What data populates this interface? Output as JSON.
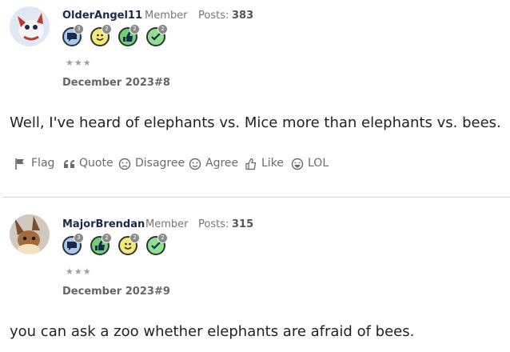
{
  "posts": [
    {
      "username": "OlderAngel11",
      "role": "Member",
      "posts_label": "Posts:",
      "posts_count": "383",
      "badges": [
        {
          "icon": "speech-bubble-icon",
          "count": "3",
          "color": "#a9c9f0"
        },
        {
          "icon": "smiley-face-icon",
          "count": "2",
          "color": "#f6e97a"
        },
        {
          "icon": "thumbs-up-icon",
          "count": "2",
          "color": "#6fd07a"
        },
        {
          "icon": "check-mark-icon",
          "count": "2",
          "color": "#8fe08f"
        }
      ],
      "stars": "★★★",
      "date": "December 2023",
      "post_number": "#8",
      "body": "Well, I've heard of elephants vs. Mice more than elephants vs. bees.",
      "actions": [
        "Flag",
        "Quote",
        "Disagree",
        "Agree",
        "Like",
        "LOL"
      ]
    },
    {
      "username": "MajorBrendan",
      "role": "Member",
      "posts_label": "Posts:",
      "posts_count": "315",
      "badges": [
        {
          "icon": "speech-bubble-icon",
          "count": "3",
          "color": "#a9c9f0"
        },
        {
          "icon": "thumbs-up-icon",
          "count": "2",
          "color": "#6fd07a"
        },
        {
          "icon": "smiley-face-icon",
          "count": "2",
          "color": "#f6e97a"
        },
        {
          "icon": "check-mark-icon",
          "count": "2",
          "color": "#8fe08f"
        }
      ],
      "stars": "★★★",
      "date": "December 2023",
      "post_number": "#9",
      "body": "you can ask a zoo whether elephants are afraid of bees."
    }
  ]
}
